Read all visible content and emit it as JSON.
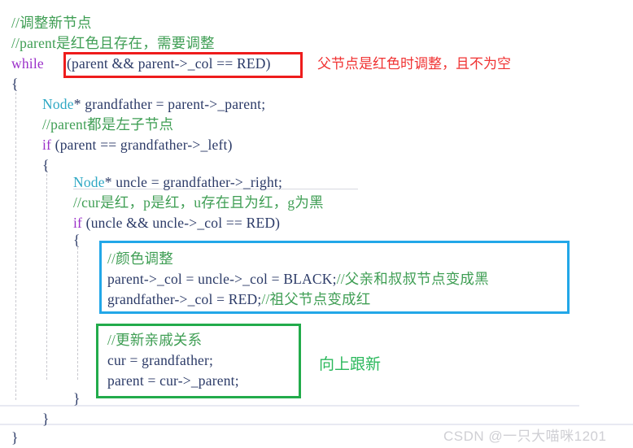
{
  "editor": {
    "language": "cpp",
    "background": "#ffffff",
    "colors": {
      "keyword": "#9b30c9",
      "type": "#2fa8c4",
      "identifier": "#2b3a67",
      "comment": "#3f9e54",
      "annotation_red": "#f03232",
      "annotation_green": "#2bb85c",
      "box_red": "#ee1c1c",
      "box_cyan": "#22a7e8",
      "box_green": "#22ab4b",
      "indent_guide": "#c9c9cf"
    },
    "lines": [
      {
        "id": "l1",
        "indent": 0,
        "text": "//调整新节点"
      },
      {
        "id": "l2",
        "indent": 0,
        "text": "//parent是红色且存在，需要调整"
      },
      {
        "id": "l3a",
        "indent": 0,
        "text": "while "
      },
      {
        "id": "l3b",
        "indent": 0,
        "text": "(parent && parent->_col == RED)"
      },
      {
        "id": "l4",
        "indent": 0,
        "text": "{"
      },
      {
        "id": "l5",
        "indent": 1,
        "text": "Node* grandfather = parent->_parent;"
      },
      {
        "id": "l6",
        "indent": 1,
        "text": "//parent都是左子节点"
      },
      {
        "id": "l7",
        "indent": 1,
        "text": "if (parent == grandfather->_left)"
      },
      {
        "id": "l8",
        "indent": 1,
        "text": "{"
      },
      {
        "id": "l9",
        "indent": 2,
        "text": "Node* uncle = grandfather->_right;"
      },
      {
        "id": "l10",
        "indent": 2,
        "text": "//cur是红，p是红，u存在且为红，g为黑"
      },
      {
        "id": "l11",
        "indent": 2,
        "text": "if (uncle && uncle->_col == RED)"
      },
      {
        "id": "l12",
        "indent": 2,
        "text": "{"
      },
      {
        "id": "l13",
        "indent": 3,
        "text": "//颜色调整"
      },
      {
        "id": "l14",
        "indent": 3,
        "text": "parent->_col = uncle->_col = BLACK;//父亲和叔叔节点变成黑"
      },
      {
        "id": "l15",
        "indent": 3,
        "text": "grandfather->_col = RED;//祖父节点变成红"
      },
      {
        "id": "l16",
        "indent": 3,
        "text": "//更新亲戚关系"
      },
      {
        "id": "l17",
        "indent": 3,
        "text": "cur = grandfather;"
      },
      {
        "id": "l18",
        "indent": 3,
        "text": "parent = cur->_parent;"
      },
      {
        "id": "l19",
        "indent": 2,
        "text": "}"
      },
      {
        "id": "l20",
        "indent": 1,
        "text": "}"
      },
      {
        "id": "l21",
        "indent": 0,
        "text": "}"
      }
    ]
  },
  "code_tokens": {
    "l1": [
      {
        "t": "//调整新节点",
        "c": "t-comment"
      }
    ],
    "l2": [
      {
        "t": "//parent是红色且存在，需要调整",
        "c": "t-comment"
      }
    ],
    "l3a": [
      {
        "t": "while",
        "c": "t-kw"
      },
      {
        "t": " ",
        "c": "t-punc"
      }
    ],
    "l3b": [
      {
        "t": "(parent && parent->_col == RED)",
        "c": "t-id"
      }
    ],
    "l4": [
      {
        "t": "{",
        "c": "t-punc"
      }
    ],
    "l5": [
      {
        "t": "Node",
        "c": "t-type"
      },
      {
        "t": "* grandfather = parent->_parent;",
        "c": "t-id"
      }
    ],
    "l6": [
      {
        "t": "//parent都是左子节点",
        "c": "t-comment"
      }
    ],
    "l7": [
      {
        "t": "if",
        "c": "t-kw"
      },
      {
        "t": " (parent == grandfather->_left)",
        "c": "t-id"
      }
    ],
    "l8": [
      {
        "t": "{",
        "c": "t-punc"
      }
    ],
    "l9": [
      {
        "t": "Node",
        "c": "t-type"
      },
      {
        "t": "* uncle = grandfather->_right;",
        "c": "t-id"
      }
    ],
    "l10": [
      {
        "t": "//cur是红，p是红，u存在且为红，g为黑",
        "c": "t-comment"
      }
    ],
    "l11": [
      {
        "t": "if",
        "c": "t-kw"
      },
      {
        "t": " (uncle && uncle->_col == RED)",
        "c": "t-id"
      }
    ],
    "l12": [
      {
        "t": "{",
        "c": "t-punc"
      }
    ],
    "l13": [
      {
        "t": "//颜色调整",
        "c": "t-comment"
      }
    ],
    "l14": [
      {
        "t": "parent->_col = uncle->_col = BLACK;",
        "c": "t-id"
      },
      {
        "t": "//父亲和叔叔节点变成黑",
        "c": "t-comment"
      }
    ],
    "l15": [
      {
        "t": "grandfather->_col = RED;",
        "c": "t-id"
      },
      {
        "t": "//祖父节点变成红",
        "c": "t-comment"
      }
    ],
    "l16": [
      {
        "t": "//更新亲戚关系",
        "c": "t-comment"
      }
    ],
    "l17": [
      {
        "t": "cur = grandfather;",
        "c": "t-id"
      }
    ],
    "l18": [
      {
        "t": "parent = cur->_parent;",
        "c": "t-id"
      }
    ],
    "l19": [
      {
        "t": "}",
        "c": "t-punc"
      }
    ],
    "l20": [
      {
        "t": "}",
        "c": "t-punc"
      }
    ],
    "l21": [
      {
        "t": "}",
        "c": "t-punc"
      }
    ]
  },
  "annotations": {
    "red_box_label": "父节点是红色时调整，且不为空",
    "green_box_label": "向上跟新",
    "boxes": [
      {
        "name": "while-condition-highlight",
        "color": "#ee1c1c"
      },
      {
        "name": "color-adjust-highlight",
        "color": "#22a7e8"
      },
      {
        "name": "relation-update-highlight",
        "color": "#22ab4b"
      }
    ]
  },
  "watermark": {
    "text": "CSDN @一只大喵咪1201"
  }
}
